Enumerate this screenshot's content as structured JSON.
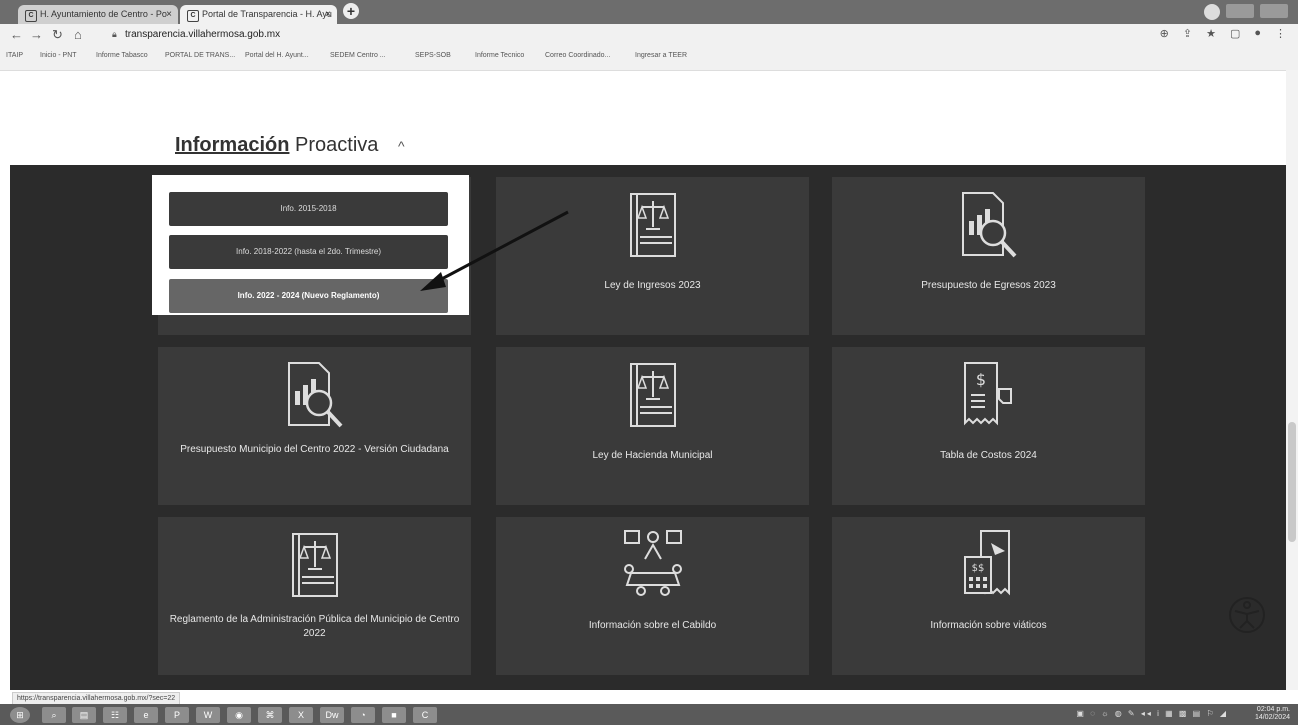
{
  "browser": {
    "tabs": [
      {
        "label": "H. Ayuntamiento de Centro - Po"
      },
      {
        "label": "Portal de Transparencia - H. Ayu"
      }
    ],
    "url": "transparencia.villahermosa.gob.mx",
    "bookmarks": [
      "ITAIP",
      "Inicio - PNT",
      "Informe Tabasco",
      "PORTAL DE TRANS...",
      "Portal del H. Ayunt...",
      "SEDEM Centro ...",
      "SEPS-SOB",
      "Informe Tecnico",
      "Correo Coordinado...",
      "Ingresar a TEER"
    ]
  },
  "section": {
    "title_bold": "Información",
    "title_rest": "Proactiva",
    "caret": "^"
  },
  "dropdown": {
    "items": [
      {
        "label": "Info. 2015-2018"
      },
      {
        "label": "Info. 2018-2022 (hasta el 2do. Trimestre)"
      },
      {
        "label": "Info. 2022 - 2024 (Nuevo Reglamento)"
      }
    ]
  },
  "cards": [
    {
      "label": "Ley de Ingresos 2023",
      "icon": "law-book-icon"
    },
    {
      "label": "Presupuesto de Egresos 2023",
      "icon": "budget-report-icon"
    },
    {
      "label": "Presupuesto Municipio del Centro 2022 - Versión Ciudadana",
      "icon": "budget-report-icon"
    },
    {
      "label": "Ley de Hacienda Municipal",
      "icon": "law-book-icon"
    },
    {
      "label": "Tabla de Costos 2024",
      "icon": "receipt-icon"
    },
    {
      "label": "Reglamento de la Administración Pública del Municipio de Centro 2022",
      "icon": "law-book-icon"
    },
    {
      "label": "Información sobre el Cabildo",
      "icon": "council-icon"
    },
    {
      "label": "Información sobre viáticos",
      "icon": "travel-expenses-icon"
    }
  ],
  "status_url": "https://transparencia.villahermosa.gob.mx/?sec=22",
  "clock": {
    "time": "02:04 p.m.",
    "date": "14/02/2024"
  }
}
